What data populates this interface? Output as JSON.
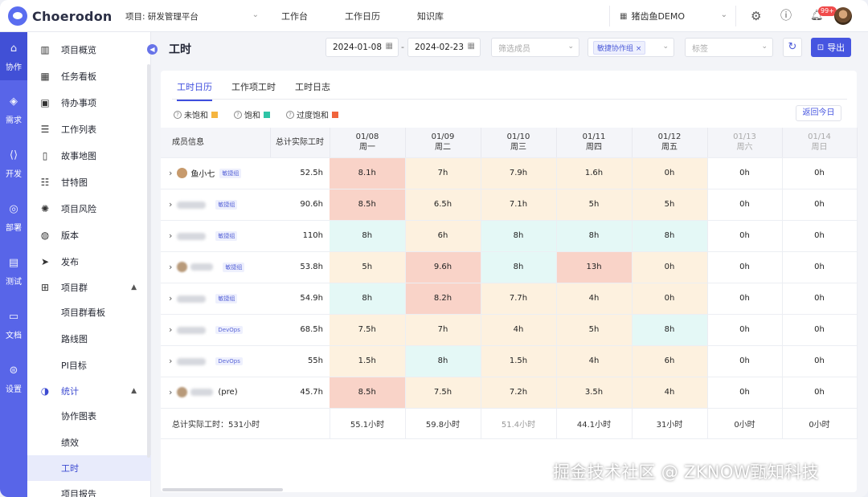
{
  "app": {
    "brand": "Choerodon",
    "project_select": "项目: 研发管理平台",
    "nav": [
      "工作台",
      "工作日历",
      "知识库"
    ],
    "org": "猪齿鱼DEMO",
    "notify_badge": "99+"
  },
  "rail": [
    {
      "label": "协作",
      "icon": "team-icon"
    },
    {
      "label": "需求",
      "icon": "layers-icon"
    },
    {
      "label": "开发",
      "icon": "code-icon"
    },
    {
      "label": "部署",
      "icon": "deploy-icon"
    },
    {
      "label": "测试",
      "icon": "clipboard-icon"
    },
    {
      "label": "文档",
      "icon": "folder-icon"
    },
    {
      "label": "设置",
      "icon": "settings-icon"
    }
  ],
  "sidebar": {
    "items": [
      "项目概览",
      "任务看板",
      "待办事项",
      "工作列表",
      "故事地图",
      "甘特图",
      "项目风险",
      "版本",
      "发布",
      "项目群",
      "项目群看板",
      "路线图",
      "PI目标",
      "统计",
      "协作图表",
      "绩效",
      "工时",
      "项目报告"
    ]
  },
  "header": {
    "title": "工时",
    "start_date": "2024-01-08",
    "end_date": "2024-02-23",
    "member_placeholder": "筛选成员",
    "group_chip": "敏捷协作组",
    "tag_placeholder": "标签",
    "export_label": "导出"
  },
  "tabs": [
    "工时日历",
    "工作项工时",
    "工时日志"
  ],
  "legend": [
    {
      "label": "未饱和",
      "color": "#f5b53f"
    },
    {
      "label": "饱和",
      "color": "#2ec4a6"
    },
    {
      "label": "过度饱和",
      "color": "#f0643c"
    }
  ],
  "today_label": "返回今日",
  "table": {
    "member_header": "成员信息",
    "total_header": "总计实际工时",
    "days": [
      {
        "date": "01/08",
        "weekday": "周一"
      },
      {
        "date": "01/09",
        "weekday": "周二"
      },
      {
        "date": "01/10",
        "weekday": "周三"
      },
      {
        "date": "01/11",
        "weekday": "周四"
      },
      {
        "date": "01/12",
        "weekday": "周五"
      },
      {
        "date": "01/13",
        "weekday": "周六"
      },
      {
        "date": "01/14",
        "weekday": "周日"
      }
    ],
    "rows": [
      {
        "name": "鱼小七",
        "group": "敏捷组",
        "total": "52.5h",
        "hours": [
          "8.1h",
          "7h",
          "7.9h",
          "1.6h",
          "0h",
          "0h",
          "0h"
        ],
        "status": [
          "over",
          "under",
          "under",
          "under",
          "under",
          "none",
          "none"
        ]
      },
      {
        "name": "",
        "group": "敏捷组",
        "total": "90.6h",
        "hours": [
          "8.5h",
          "6.5h",
          "7.1h",
          "5h",
          "5h",
          "0h",
          "0h"
        ],
        "status": [
          "over",
          "under",
          "under",
          "under",
          "under",
          "none",
          "none"
        ]
      },
      {
        "name": "",
        "group": "敏捷组",
        "total": "110h",
        "hours": [
          "8h",
          "6h",
          "8h",
          "8h",
          "8h",
          "0h",
          "0h"
        ],
        "status": [
          "full",
          "under",
          "full",
          "full",
          "full",
          "none",
          "none"
        ]
      },
      {
        "name": "",
        "group": "敏捷组",
        "total": "53.8h",
        "hours": [
          "5h",
          "9.6h",
          "8h",
          "13h",
          "0h",
          "0h",
          "0h"
        ],
        "status": [
          "under",
          "over",
          "full",
          "over",
          "under",
          "none",
          "none"
        ]
      },
      {
        "name": "",
        "group": "敏捷组",
        "total": "54.9h",
        "hours": [
          "8h",
          "8.2h",
          "7.7h",
          "4h",
          "0h",
          "0h",
          "0h"
        ],
        "status": [
          "full",
          "over",
          "under",
          "under",
          "under",
          "none",
          "none"
        ]
      },
      {
        "name": "",
        "group": "DevOps",
        "total": "68.5h",
        "hours": [
          "7.5h",
          "7h",
          "4h",
          "5h",
          "8h",
          "0h",
          "0h"
        ],
        "status": [
          "under",
          "under",
          "under",
          "under",
          "full",
          "none",
          "none"
        ]
      },
      {
        "name": "",
        "group": "DevOps",
        "total": "55h",
        "hours": [
          "1.5h",
          "8h",
          "1.5h",
          "4h",
          "6h",
          "0h",
          "0h"
        ],
        "status": [
          "under",
          "full",
          "under",
          "under",
          "under",
          "none",
          "none"
        ]
      },
      {
        "name": "(pre)",
        "group": "",
        "total": "45.7h",
        "hours": [
          "8.5h",
          "7.5h",
          "7.2h",
          "3.5h",
          "4h",
          "0h",
          "0h"
        ],
        "status": [
          "over",
          "under",
          "under",
          "under",
          "under",
          "none",
          "none"
        ]
      }
    ],
    "footer_total": "总计实际工时：531小时",
    "footer_days": [
      "55.1小时",
      "59.8小时",
      "51.4小时",
      "44.1小时",
      "31小时",
      "0小时",
      "0小时"
    ]
  },
  "watermark": "掘金技术社区 @ ZKNOW甄知科技"
}
